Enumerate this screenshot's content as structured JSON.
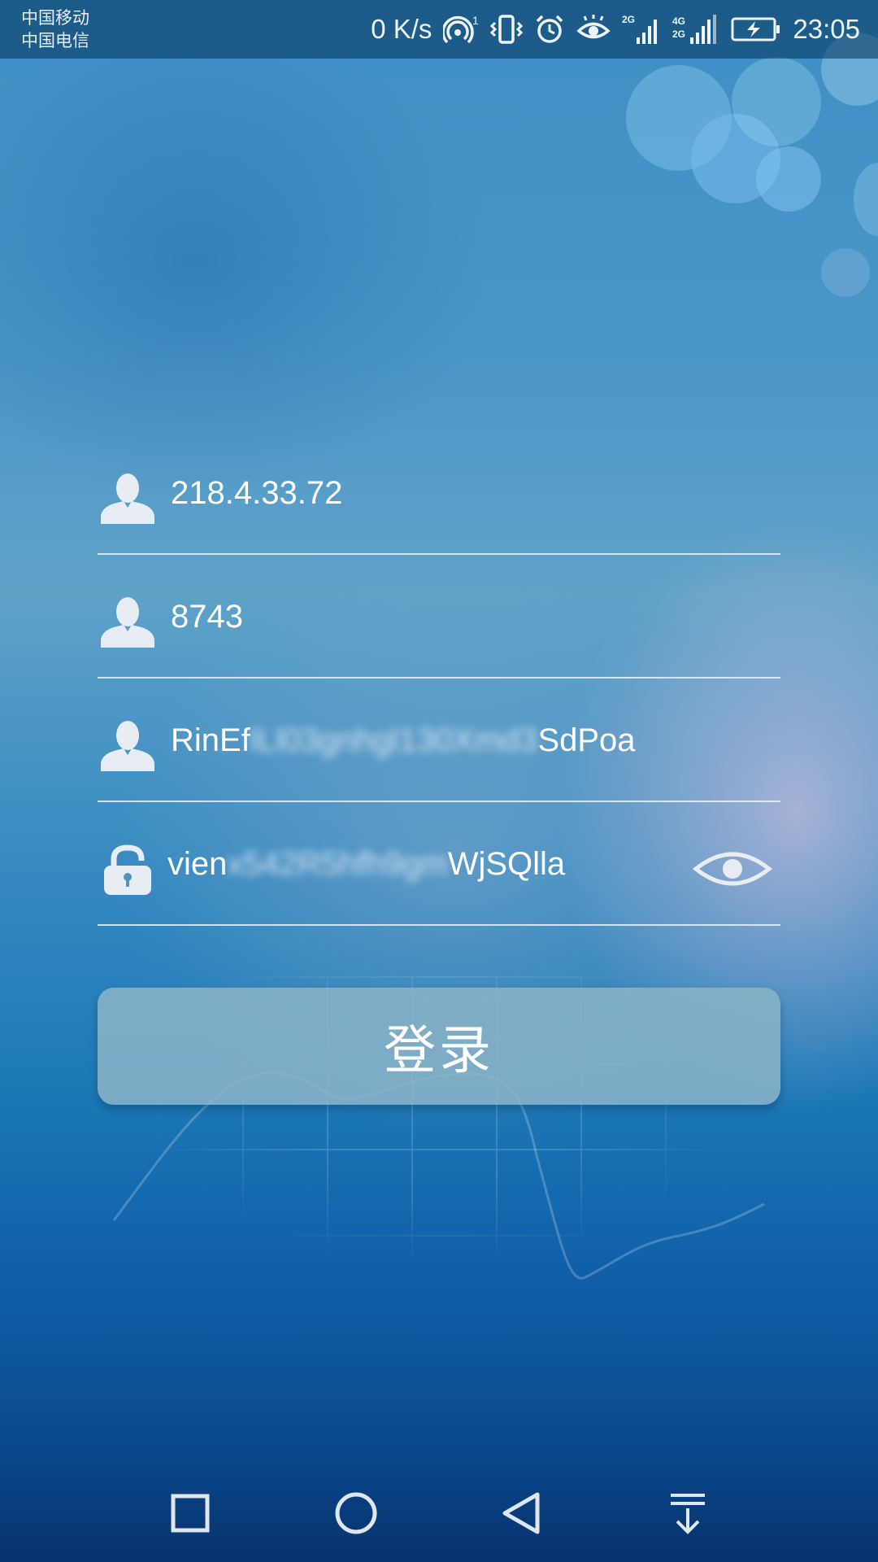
{
  "status_bar": {
    "carrier_1": "中国移动",
    "carrier_2": "中国电信",
    "net_speed": "0 K/s",
    "hotspot_badge": "1",
    "network_2g": "2G",
    "network_4g": "4G",
    "network_2g_b": "2G",
    "time": "23:05"
  },
  "form": {
    "server_address": "218.4.33.72",
    "port": "8743",
    "username_prefix": "RinEf",
    "username_masked": "lLl03gnhgl130Xmd3",
    "username_suffix": "SdPoa",
    "password_prefix": "vien",
    "password_masked": "x542R5hfh9gm",
    "password_suffix": "WjSQlla",
    "login_label": "登录"
  },
  "icons": {
    "server": "user-icon",
    "port": "user-icon",
    "username": "user-icon",
    "password": "lock-icon",
    "visibility": "eye-icon"
  }
}
